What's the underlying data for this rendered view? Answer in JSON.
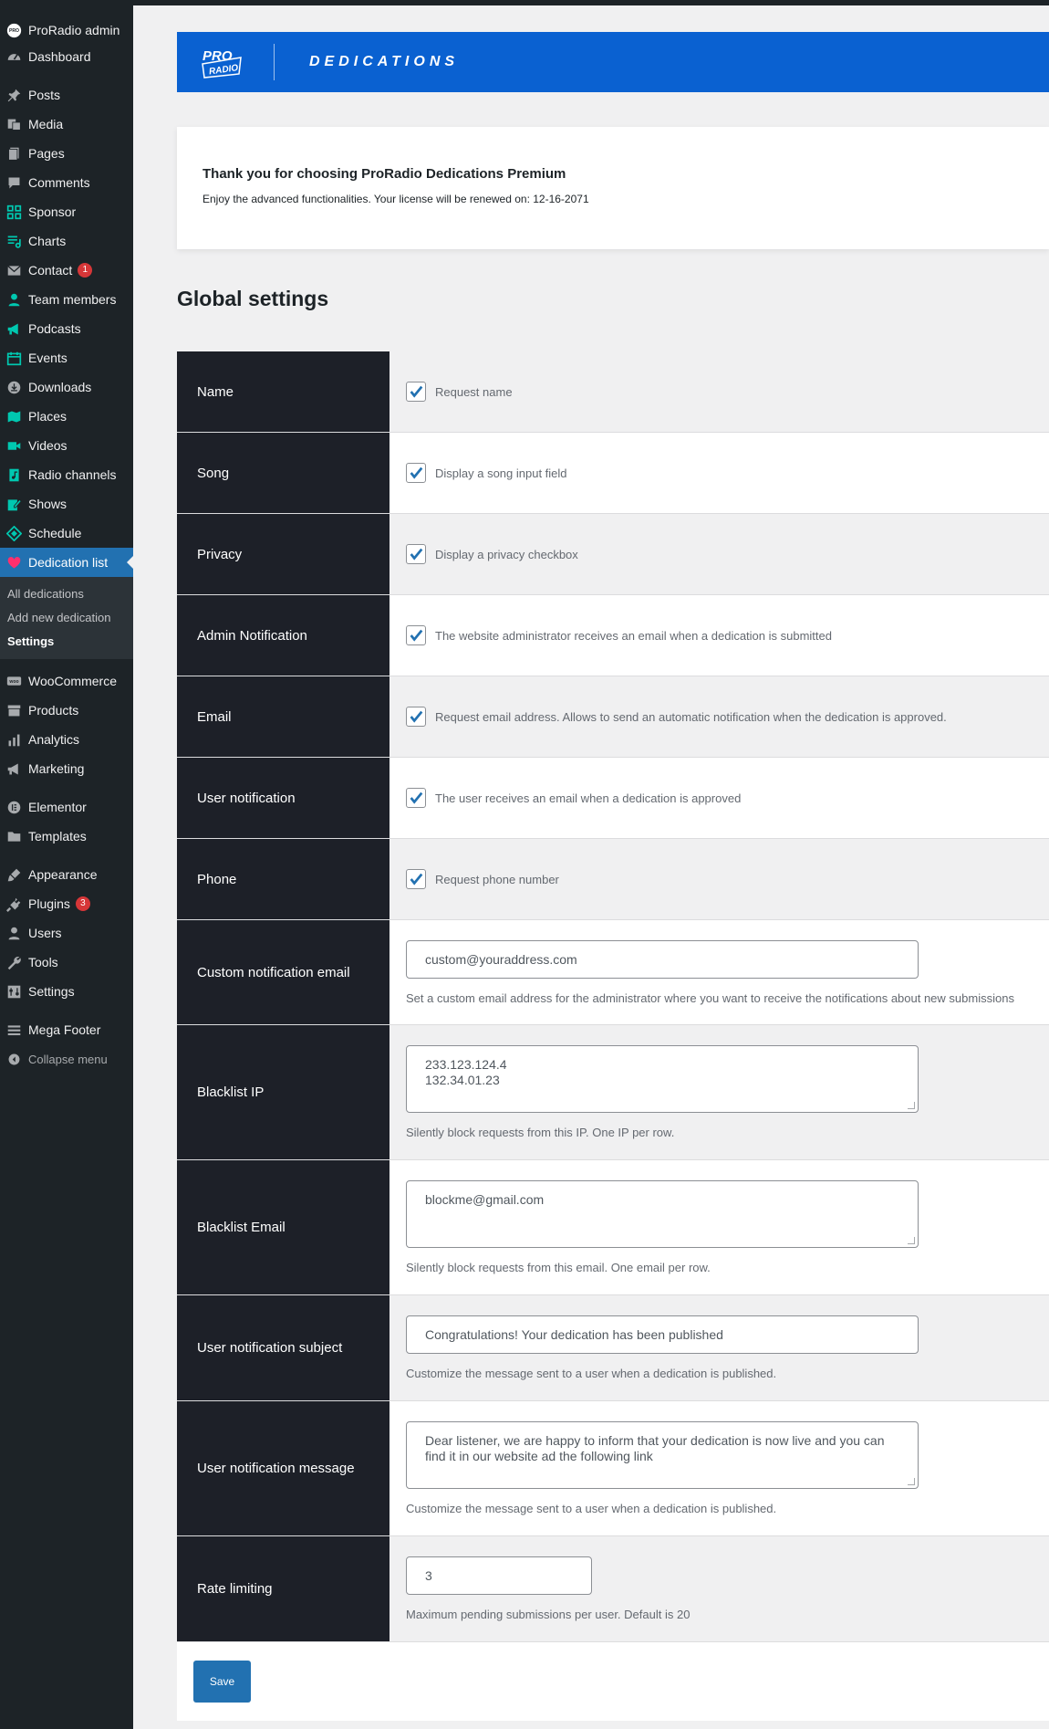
{
  "sidebar": {
    "site_name": "ProRadio admin",
    "items": [
      {
        "label": "Dashboard",
        "icon": "dashboard-icon"
      },
      {
        "label": "Posts",
        "icon": "pin-icon"
      },
      {
        "label": "Media",
        "icon": "media-icon"
      },
      {
        "label": "Pages",
        "icon": "pages-icon"
      },
      {
        "label": "Comments",
        "icon": "comments-icon"
      },
      {
        "label": "Sponsor",
        "icon": "grid-icon"
      },
      {
        "label": "Charts",
        "icon": "playlist-icon"
      },
      {
        "label": "Contact",
        "icon": "mail-icon",
        "badge": "1"
      },
      {
        "label": "Team members",
        "icon": "person-icon"
      },
      {
        "label": "Podcasts",
        "icon": "megaphone-icon"
      },
      {
        "label": "Events",
        "icon": "calendar-icon"
      },
      {
        "label": "Downloads",
        "icon": "download-icon"
      },
      {
        "label": "Places",
        "icon": "map-icon"
      },
      {
        "label": "Videos",
        "icon": "video-icon"
      },
      {
        "label": "Radio channels",
        "icon": "audio-icon"
      },
      {
        "label": "Shows",
        "icon": "edit-icon"
      },
      {
        "label": "Schedule",
        "icon": "tag-icon"
      },
      {
        "label": "Dedication list",
        "icon": "heart-icon"
      }
    ],
    "submenu": [
      "All dedications",
      "Add new dedication",
      "Settings"
    ],
    "items2": [
      {
        "label": "WooCommerce",
        "icon": "woo-icon"
      },
      {
        "label": "Products",
        "icon": "archive-icon"
      },
      {
        "label": "Analytics",
        "icon": "bar-chart-icon"
      },
      {
        "label": "Marketing",
        "icon": "megaphone-icon"
      }
    ],
    "items3": [
      {
        "label": "Elementor",
        "icon": "elementor-icon"
      },
      {
        "label": "Templates",
        "icon": "folder-icon"
      }
    ],
    "items4": [
      {
        "label": "Appearance",
        "icon": "brush-icon"
      },
      {
        "label": "Plugins",
        "icon": "plug-icon",
        "badge": "3"
      },
      {
        "label": "Users",
        "icon": "users-icon"
      },
      {
        "label": "Tools",
        "icon": "wrench-icon"
      },
      {
        "label": "Settings",
        "icon": "settings-icon"
      }
    ],
    "items5": [
      {
        "label": "Mega Footer",
        "icon": "list-icon"
      }
    ],
    "collapse": "Collapse menu"
  },
  "banner": {
    "logo_line1": "PRO",
    "logo_line2": "RADIO",
    "title": "DEDICATIONS"
  },
  "notice": {
    "title": "Thank you for choosing ProRadio Dedications Premium",
    "text": "Enjoy the advanced functionalities. Your license will be renewed on: 12-16-2071"
  },
  "section_title": "Global settings",
  "settings": {
    "name": {
      "label": "Name",
      "text": "Request name",
      "checked": true
    },
    "song": {
      "label": "Song",
      "text": "Display a song input field",
      "checked": true
    },
    "privacy": {
      "label": "Privacy",
      "text": "Display a privacy checkbox",
      "checked": true
    },
    "admin_notification": {
      "label": "Admin Notification",
      "text": "The website administrator receives an email when a dedication is submitted",
      "checked": true
    },
    "email": {
      "label": "Email",
      "text": "Request email address. Allows to send an automatic notification when the dedication is approved.",
      "checked": true
    },
    "user_notification": {
      "label": "User notification",
      "text": "The user receives an email when a dedication is approved",
      "checked": true
    },
    "phone": {
      "label": "Phone",
      "text": "Request phone number",
      "checked": true
    },
    "custom_email": {
      "label": "Custom notification email",
      "value": "custom@youraddress.com",
      "desc": "Set a custom email address for the administrator where you want to receive the notifications about new submissions"
    },
    "blacklist_ip": {
      "label": "Blacklist IP",
      "value": "233.123.124.4\n132.34.01.23",
      "desc": "Silently block requests from this IP. One IP per row."
    },
    "blacklist_email": {
      "label": "Blacklist Email",
      "value": "blockme@gmail.com",
      "desc": "Silently block requests from this email. One email per row."
    },
    "subject": {
      "label": "User notification subject",
      "value": "Congratulations! Your dedication has been published",
      "desc": "Customize the message sent to a user when a dedication is published."
    },
    "message": {
      "label": "User notification message",
      "value": "Dear listener, we are happy to inform that your dedication is now live and you can find it in our website ad the following link",
      "desc": "Customize the message sent to a user when a dedication is published."
    },
    "rate_limiting": {
      "label": "Rate limiting",
      "value": "3",
      "desc": "Maximum pending submissions per user. Default is 20"
    }
  },
  "save_label": "Save",
  "colors": {
    "sidebar": "#1d2327",
    "accent": "#2271b1",
    "banner": "#0a61d1",
    "icon_teal": "#00c8b0",
    "checkbox_blue": "#2271b1"
  }
}
